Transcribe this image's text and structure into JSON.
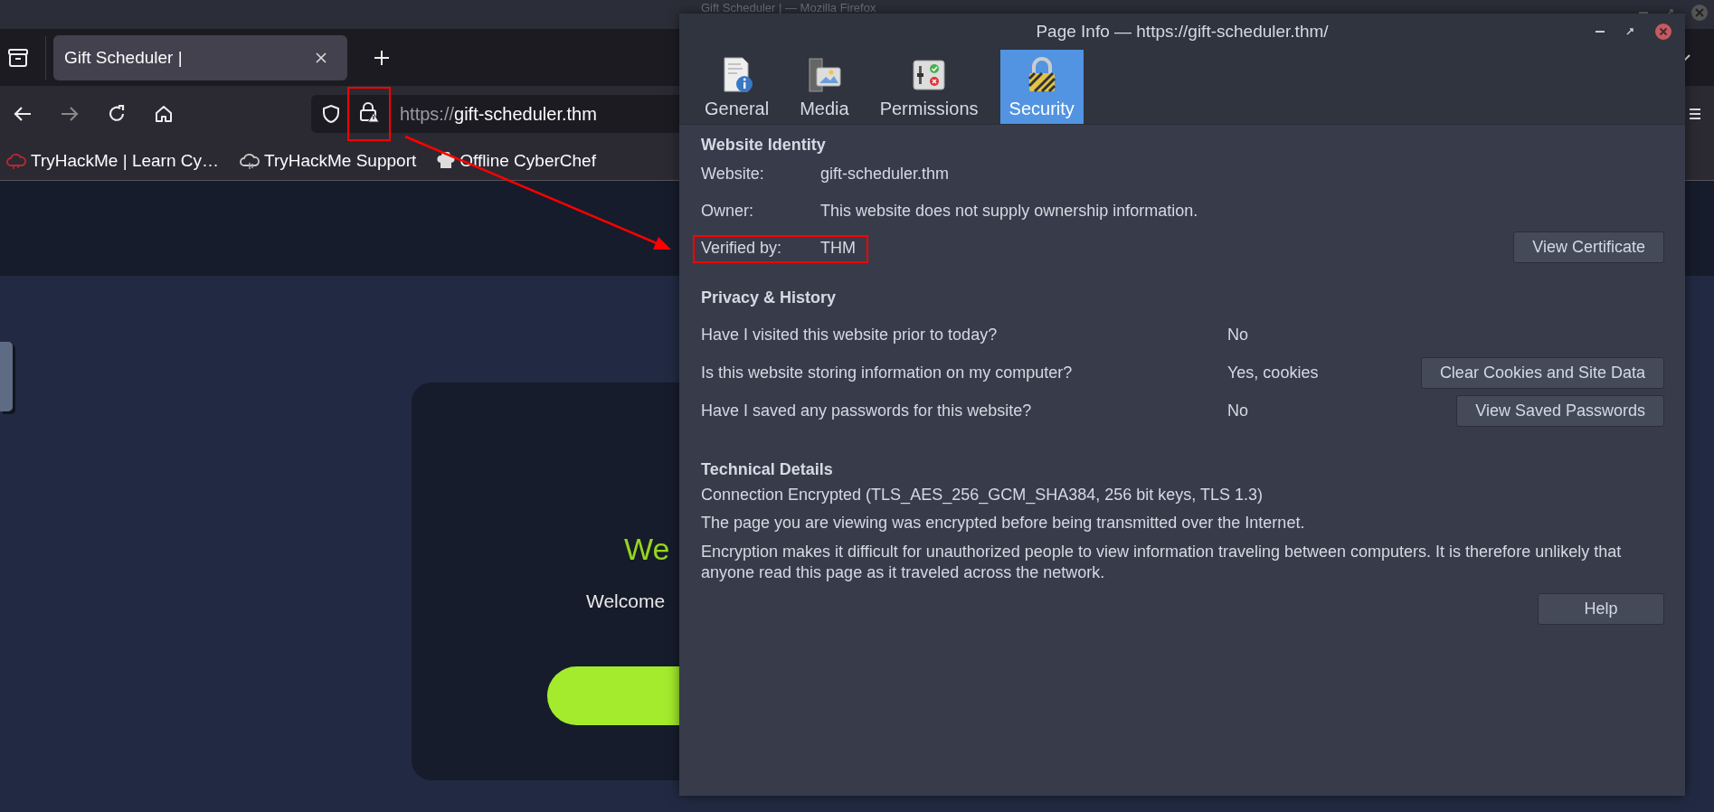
{
  "desktop": {
    "window_title": "Gift Scheduler | — Mozilla Firefox"
  },
  "browser": {
    "tabs": [
      {
        "label": "Gift Scheduler |",
        "selected": true
      }
    ],
    "url": {
      "scheme": "https://",
      "host": "gift-scheduler.thm"
    },
    "lock_highlighted": true,
    "bookmarks": [
      {
        "label": "TryHackMe | Learn Cy…"
      },
      {
        "label": "TryHackMe Support"
      },
      {
        "label": "Offline CyberChef"
      }
    ]
  },
  "page": {
    "heading": "We",
    "text": "Welcome"
  },
  "dialog": {
    "title": "Page Info — https://gift-scheduler.thm/",
    "tabs": [
      {
        "label": "General",
        "selected": false
      },
      {
        "label": "Media",
        "selected": false
      },
      {
        "label": "Permissions",
        "selected": false
      },
      {
        "label": "Security",
        "selected": true
      }
    ],
    "identity": {
      "heading": "Website Identity",
      "rows": [
        {
          "label": "Website:",
          "value": "gift-scheduler.thm",
          "highlighted": false
        },
        {
          "label": "Owner:",
          "value": "This website does not supply ownership information.",
          "highlighted": false
        },
        {
          "label": "Verified by:",
          "value": "THM",
          "highlighted": true
        }
      ],
      "button": "View Certificate"
    },
    "privacy": {
      "heading": "Privacy & History",
      "rows": [
        {
          "question": "Have I visited this website prior to today?",
          "answer": "No"
        },
        {
          "question": "Is this website storing information on my computer?",
          "answer": "Yes, cookies",
          "button": "Clear Cookies and Site Data"
        },
        {
          "question": "Have I saved any passwords for this website?",
          "answer": "No",
          "button": "View Saved Passwords"
        }
      ]
    },
    "technical": {
      "heading": "Technical Details",
      "lines": [
        "Connection Encrypted (TLS_AES_256_GCM_SHA384, 256 bit keys, TLS 1.3)",
        "The page you are viewing was encrypted before being transmitted over the Internet.",
        "Encryption makes it difficult for unauthorized people to view information traveling between computers. It is therefore unlikely that anyone read this page as it traveled across the network."
      ]
    },
    "help_button": "Help"
  },
  "annotation": {
    "arrow": true
  }
}
